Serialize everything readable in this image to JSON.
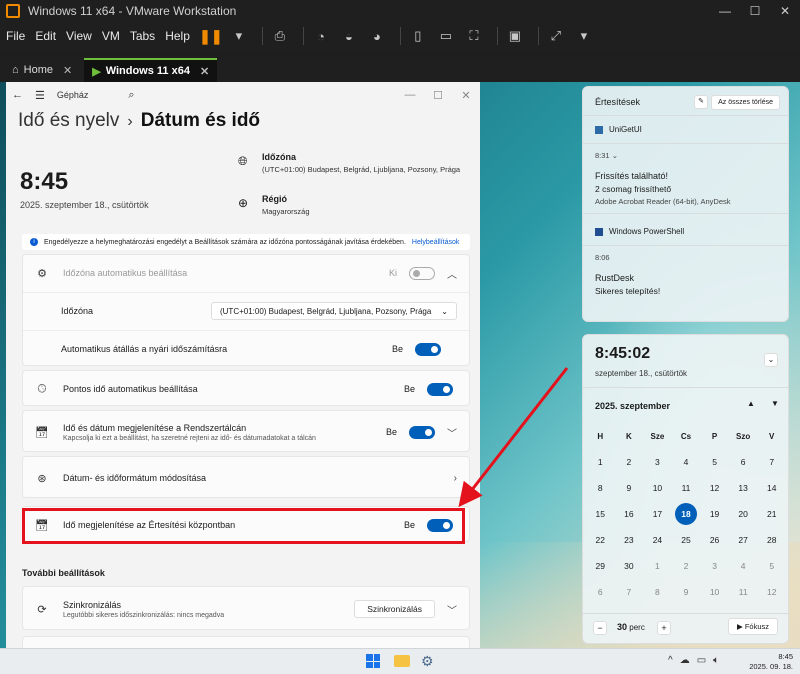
{
  "vmware": {
    "title": "Windows 11 x64 - VMware Workstation",
    "menus": [
      "File",
      "Edit",
      "View",
      "VM",
      "Tabs",
      "Help"
    ],
    "tabs": [
      {
        "label": "Home"
      },
      {
        "label": "Windows 11 x64"
      }
    ]
  },
  "settings": {
    "app_title": "Gépház",
    "breadcrumb_parent": "Idő és nyelv",
    "breadcrumb_sep": "›",
    "breadcrumb_current": "Dátum és idő",
    "clock": "8:45",
    "date": "2025. szeptember 18., csütörtök",
    "timezone_label": "Időzóna",
    "timezone_value": "(UTC+01:00) Budapest, Belgrád, Ljubljana, Pozsony, Prága",
    "region_label": "Régió",
    "region_value": "Magyarország",
    "info_text": "Engedélyezze a helymeghatározási engedélyt a Beállítások számára az időzóna pontosságának javítása érdekében.",
    "info_link": "Helybeállítások",
    "auto_tz": {
      "label": "Időzóna automatikus beállítása",
      "state": "Ki"
    },
    "tz_row": {
      "label": "Időzóna",
      "value": "(UTC+01:00) Budapest, Belgrád, Ljubljana, Pozsony, Prága"
    },
    "dst_row": {
      "label": "Automatikus átállás a nyári időszámításra",
      "state": "Be"
    },
    "auto_time": {
      "label": "Pontos idő automatikus beállítása",
      "state": "Be"
    },
    "taskbar_show": {
      "label": "Idő és dátum megjelenítése a Rendszertálcán",
      "sub": "Kapcsolja ki ezt a beállítást, ha szeretné rejteni az idő- és dátumadatokat a tálcán",
      "state": "Be"
    },
    "format_row": {
      "label": "Dátum- és időformátum módosítása"
    },
    "notif_center": {
      "label": "Idő megjelenítése az Értesítési központban",
      "state": "Be"
    },
    "more_header": "További beállítások",
    "sync": {
      "label": "Szinkronizálás",
      "sub": "Legutóbbi sikeres időszinkronizálás: nincs megadva",
      "button": "Szinkronizálás"
    }
  },
  "notifications": {
    "header": "Értesítések",
    "clear_all": "Az összes törlése",
    "app1": "UniGetUI",
    "app1_time": "8:31",
    "app1_title": "Frissítés található!",
    "app1_body": "2 csomag frissíthető",
    "app1_detail": "Adobe Acrobat Reader (64-bit), AnyDesk",
    "app2": "Windows PowerShell",
    "app2_time": "8:06",
    "app2_title": "RustDesk",
    "app2_body": "Sikeres telepítés!"
  },
  "calendar": {
    "time": "8:45:02",
    "date": "szeptember 18., csütörtök",
    "month": "2025. szeptember",
    "weekdays": [
      "H",
      "K",
      "Sze",
      "Cs",
      "P",
      "Szo",
      "V"
    ],
    "days": [
      "1",
      "2",
      "3",
      "4",
      "5",
      "6",
      "7",
      "8",
      "9",
      "10",
      "11",
      "12",
      "13",
      "14",
      "15",
      "16",
      "17",
      "18",
      "19",
      "20",
      "21",
      "22",
      "23",
      "24",
      "25",
      "26",
      "27",
      "28",
      "29",
      "30",
      "1",
      "2",
      "3",
      "4",
      "5",
      "6",
      "7",
      "8",
      "9",
      "10",
      "11",
      "12"
    ],
    "today": "18",
    "focus_minutes": "30",
    "focus_unit": "perc",
    "focus_button": "Fókusz"
  },
  "taskbar": {
    "time": "8:45",
    "date": "2025. 09. 18."
  },
  "colors": {
    "accent": "#005fb8",
    "highlight": "#e3121c",
    "vmware_orange": "#f08a00"
  }
}
